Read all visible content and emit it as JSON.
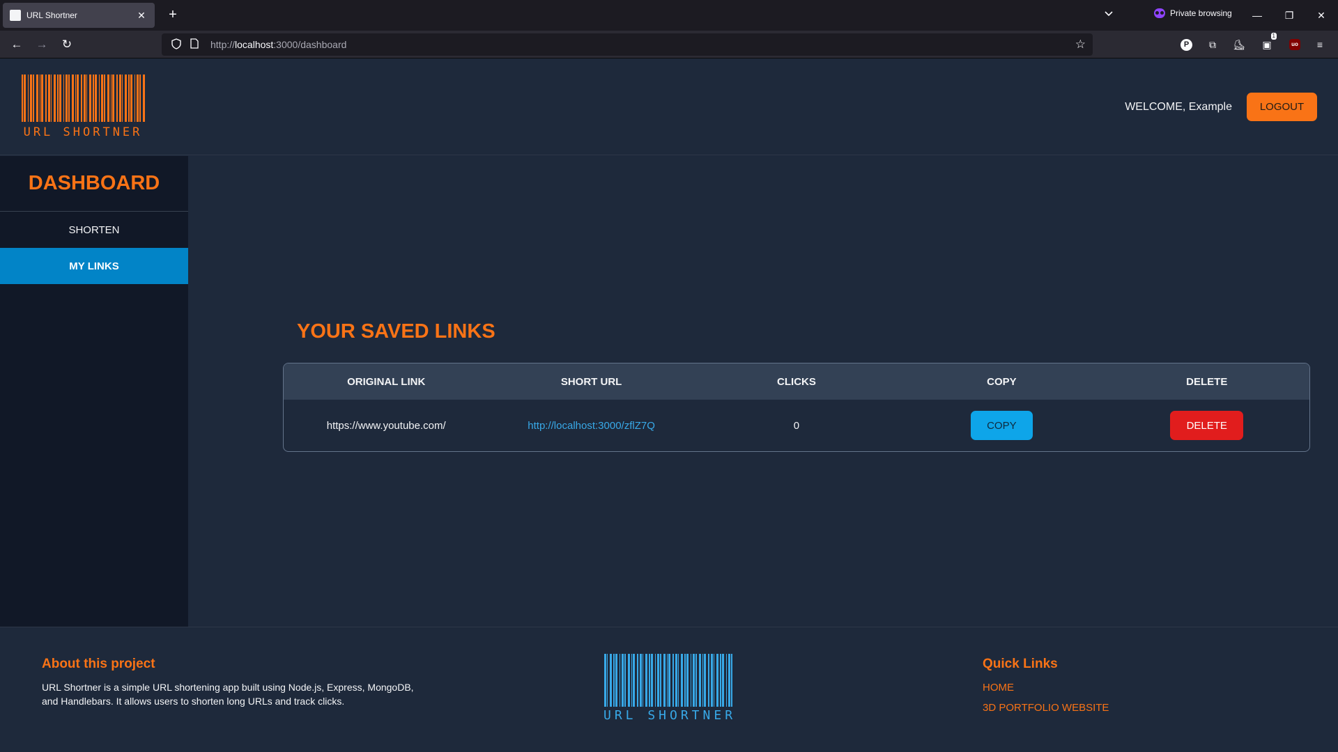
{
  "browser": {
    "tab_title": "URL Shortner",
    "private_label": "Private browsing",
    "url_prefix": "http://",
    "url_host": "localhost",
    "url_rest": ":3000/dashboard",
    "extension_badge": "1",
    "ext_p_label": "P",
    "ext_ub_label": "uo"
  },
  "header": {
    "logo_text": "URL SHORTNER",
    "welcome": "WELCOME, Example",
    "logout_label": "LOGOUT"
  },
  "sidebar": {
    "title": "DASHBOARD",
    "items": [
      {
        "label": "SHORTEN"
      },
      {
        "label": "MY LINKS"
      }
    ]
  },
  "main": {
    "title": "YOUR SAVED LINKS",
    "columns": [
      "ORIGINAL LINK",
      "SHORT URL",
      "CLICKS",
      "COPY",
      "DELETE"
    ],
    "rows": [
      {
        "original": "https://www.youtube.com/",
        "short_url": "http://localhost:3000/zflZ7Q",
        "clicks": "0",
        "copy_label": "COPY",
        "delete_label": "DELETE"
      }
    ]
  },
  "footer": {
    "about_title": "About this project",
    "about_text": "URL Shortner is a simple URL shortening app built using Node.js, Express, MongoDB, and Handlebars. It allows users to shorten long URLs and track clicks.",
    "logo_text": "URL SHORTNER",
    "quick_links_title": "Quick Links",
    "quick_links": [
      "HOME",
      "3D PORTFOLIO WEBSITE"
    ]
  },
  "colors": {
    "accent": "#f97316",
    "active_nav": "#0284c7",
    "copy": "#0ea5e9",
    "delete": "#e11d1d",
    "background": "#1e293b",
    "sidebar": "#111827"
  }
}
